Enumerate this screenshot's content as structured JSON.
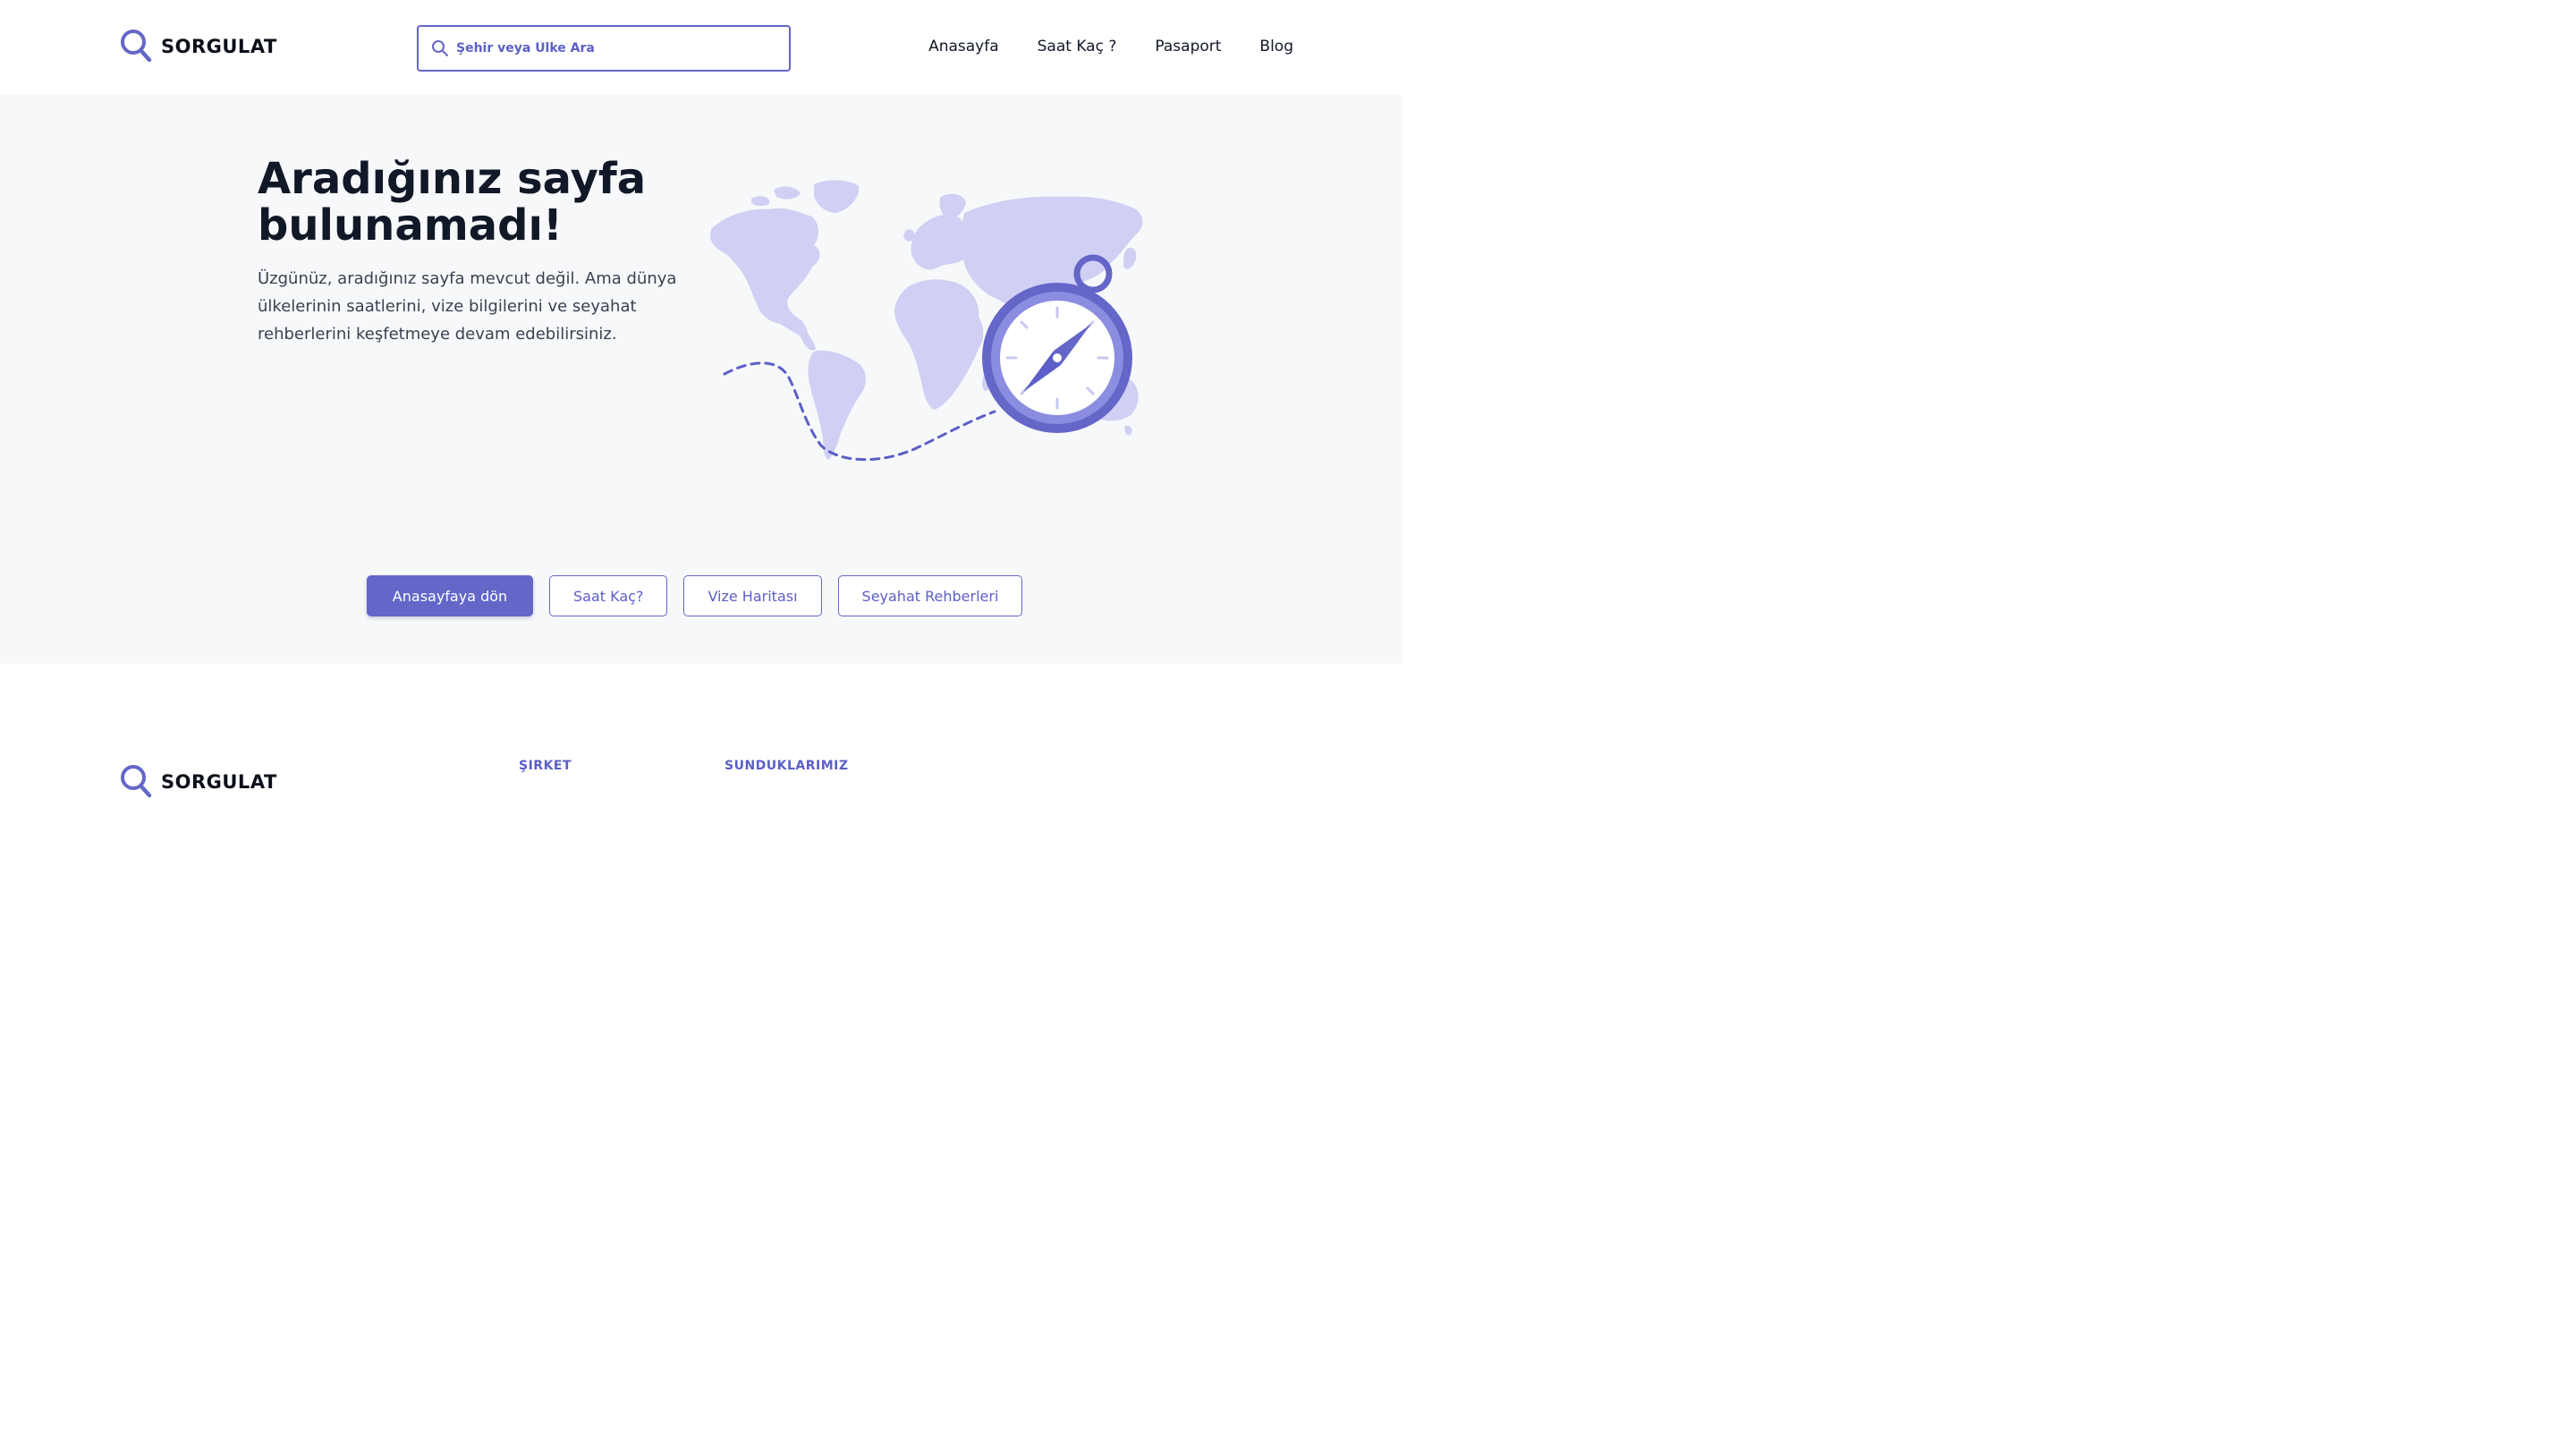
{
  "brand": {
    "name": "SORGULAT"
  },
  "search": {
    "placeholder": "Şehir veya Ülke Ara"
  },
  "nav": {
    "items": [
      "Anasayfa",
      "Saat Kaç ?",
      "Pasaport",
      "Blog"
    ]
  },
  "hero": {
    "title": "Aradığınız sayfa bulunamadı!",
    "description": "Üzgünüz, aradığınız sayfa mevcut değil. Ama dünya ülkelerinin saatlerini, vize bilgilerini ve seyahat rehberlerini keşfetmeye devam edebilirsiniz."
  },
  "actions": {
    "home": "Anasayfaya dön",
    "time": "Saat Kaç?",
    "visa_map": "Vize Haritası",
    "travel_guides": "Seyahat Rehberleri"
  },
  "footer": {
    "brand": "SORGULAT",
    "col_company": "ŞIRKET",
    "col_offerings": "SUNDUKLARIMIZ"
  },
  "colors": {
    "accent": "#6466c8",
    "map": "#cfd0f3",
    "hero_bg": "#f7f8fa"
  },
  "icons": {
    "logo": "magnifier-icon",
    "search": "search-icon",
    "illustration": "world-map-compass-illustration"
  }
}
